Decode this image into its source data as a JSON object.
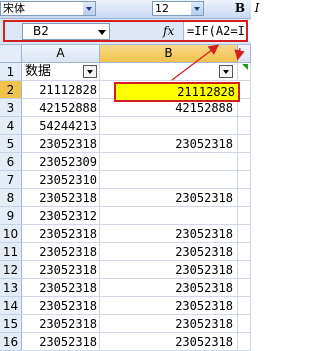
{
  "toolbar": {
    "font_name": "宋体",
    "font_size": "12",
    "bold_label": "B",
    "italic_label": "I"
  },
  "formula_bar": {
    "name_box": "B2",
    "fx_label": "fx",
    "formula": "=IF(A2=I"
  },
  "columns": [
    "A",
    "B"
  ],
  "rows": [
    {
      "num": "1",
      "a": "数据",
      "b": ""
    },
    {
      "num": "2",
      "a": "21112828",
      "b": "21112828"
    },
    {
      "num": "3",
      "a": "42152888",
      "b": "42152888"
    },
    {
      "num": "4",
      "a": "54244213",
      "b": ""
    },
    {
      "num": "5",
      "a": "23052318",
      "b": "23052318"
    },
    {
      "num": "6",
      "a": "23052309",
      "b": ""
    },
    {
      "num": "7",
      "a": "23052310",
      "b": ""
    },
    {
      "num": "8",
      "a": "23052318",
      "b": "23052318"
    },
    {
      "num": "9",
      "a": "23052312",
      "b": ""
    },
    {
      "num": "10",
      "a": "23052318",
      "b": "23052318"
    },
    {
      "num": "11",
      "a": "23052318",
      "b": "23052318"
    },
    {
      "num": "12",
      "a": "23052318",
      "b": "23052318"
    },
    {
      "num": "13",
      "a": "23052318",
      "b": "23052318"
    },
    {
      "num": "14",
      "a": "23052318",
      "b": "23052318"
    },
    {
      "num": "15",
      "a": "23052318",
      "b": "23052318"
    },
    {
      "num": "16",
      "a": "23052318",
      "b": "23052318"
    }
  ],
  "colors": {
    "highlight_fill": "#ffff00",
    "annotation_red": "#d41f1f",
    "active_column_header": "#f1c24c"
  }
}
